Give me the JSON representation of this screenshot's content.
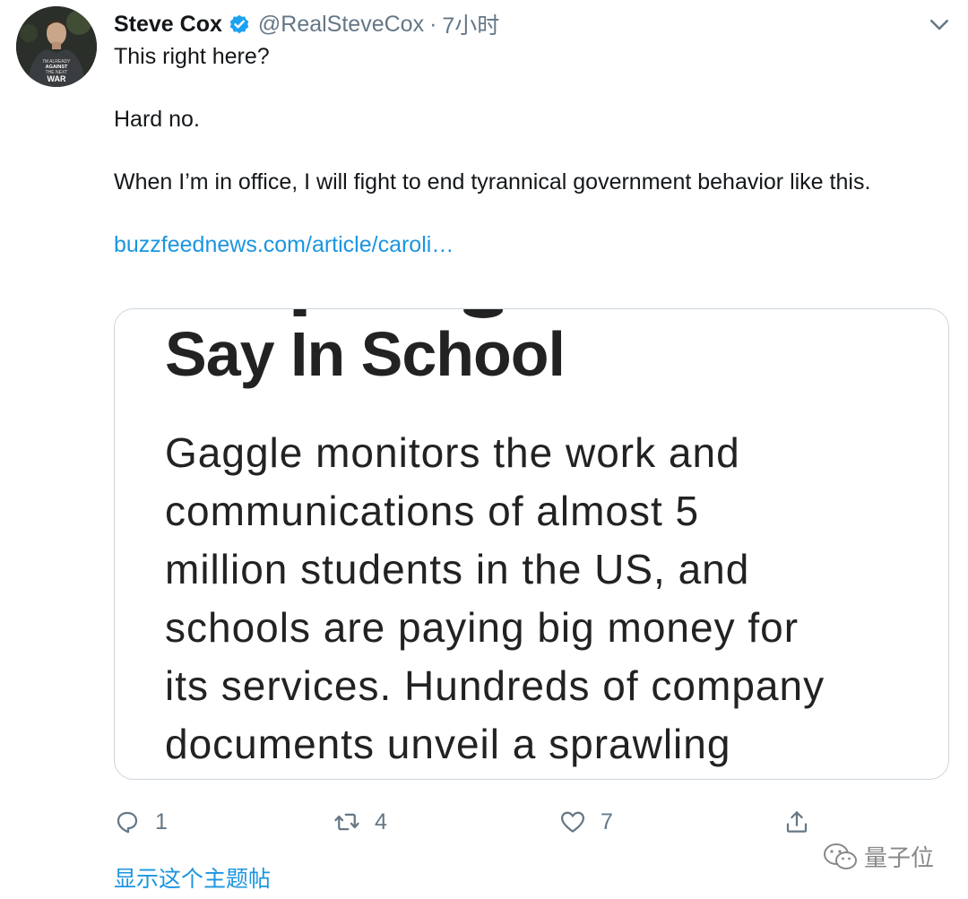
{
  "tweet": {
    "author": {
      "name": "Steve Cox",
      "handle": "@RealSteveCox",
      "separator": "·",
      "time": "7小时",
      "avatar_shirt_text": [
        "I'M ALREADY",
        "AGAINST",
        "THE NEXT",
        "WAR"
      ]
    },
    "icons": {
      "verified": "verified-badge-icon",
      "menu": "chevron-down-icon",
      "reply": "reply-icon",
      "retweet": "retweet-icon",
      "like": "heart-icon",
      "share": "share-icon"
    },
    "text": {
      "line1": "This right here?",
      "line2": "Hard no.",
      "line3": "When I’m in office, I will fight to end tyrannical government behavior like this.",
      "link": "buzzfeednews.com/article/caroli…"
    },
    "card": {
      "headline": "Say In School",
      "body_lines": [
        "Gaggle monitors the work and",
        "communications of almost 5",
        "million students in the US, and",
        "schools are paying big money for",
        "its services. Hundreds of company",
        "documents unveil a sprawling"
      ]
    },
    "actions": {
      "reply_count": "1",
      "retweet_count": "4",
      "like_count": "7"
    },
    "show_thread": "显示这个主题帖"
  },
  "watermark": {
    "text": "量子位"
  },
  "colors": {
    "link": "#1b95e0",
    "secondary_text": "#657786",
    "primary_text": "#14171a",
    "card_border": "#ccd6dd",
    "verified": "#1da1f2"
  }
}
